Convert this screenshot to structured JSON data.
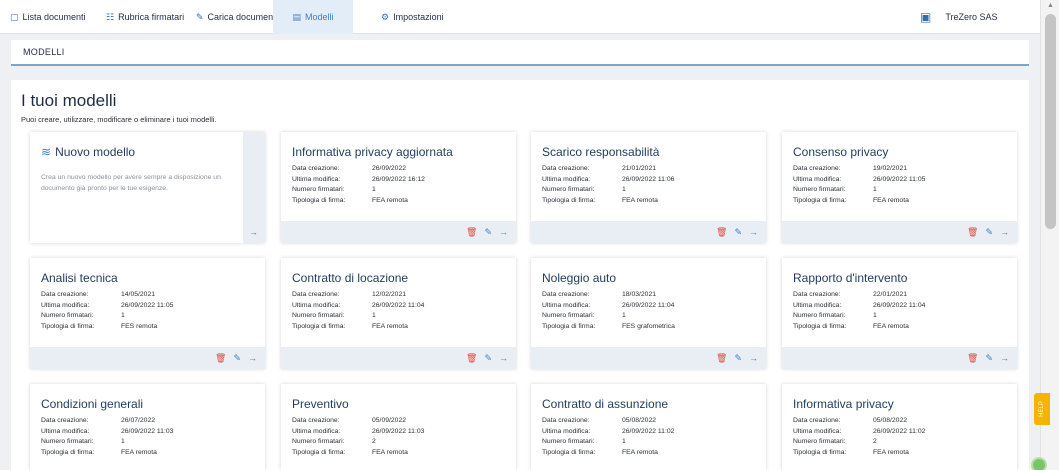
{
  "nav": {
    "items": [
      {
        "icon": "document-icon",
        "label": "Lista documenti"
      },
      {
        "icon": "contacts-icon",
        "label": "Rubrica firmatari"
      },
      {
        "icon": "pen-icon",
        "label": "Carica documento"
      },
      {
        "icon": "template-icon",
        "label": "Modelli",
        "active": true
      },
      {
        "icon": "settings-icon",
        "label": "Impostazioni"
      }
    ],
    "company": {
      "icon": "building-icon",
      "label": "TreZero SAS"
    }
  },
  "section": {
    "label": "MODELLI"
  },
  "page": {
    "title": "I tuoi modelli",
    "subtitle": "Puoi creare, utilizzare, modificare o eliminare i tuoi modelli."
  },
  "new_model": {
    "title": "Nuovo modello",
    "description": "Crea un nuovo modello per avere sempre a disposizione un documento già pronto per le tue esigenze."
  },
  "labels": {
    "created": "Data creazione:",
    "modified": "Ultima modifica:",
    "signers": "Numero firmatari:",
    "signature_type": "Tipologia di firma:"
  },
  "models": [
    {
      "title": "Informativa privacy aggiornata",
      "created": "26/09/2022",
      "modified": "26/09/2022 16:12",
      "signers": "1",
      "signature_type": "FEA remota"
    },
    {
      "title": "Scarico responsabilità",
      "created": "21/01/2021",
      "modified": "26/09/2022 11:06",
      "signers": "1",
      "signature_type": "FEA remota"
    },
    {
      "title": "Consenso privacy",
      "created": "19/02/2021",
      "modified": "26/09/2022 11:05",
      "signers": "1",
      "signature_type": "FEA remota"
    },
    {
      "title": "Analisi tecnica",
      "created": "14/05/2021",
      "modified": "26/09/2022 11:05",
      "signers": "1",
      "signature_type": "FES remota"
    },
    {
      "title": "Contratto di locazione",
      "created": "12/02/2021",
      "modified": "26/09/2022 11:04",
      "signers": "1",
      "signature_type": "FEA remota"
    },
    {
      "title": "Noleggio auto",
      "created": "18/03/2021",
      "modified": "26/09/2022 11:04",
      "signers": "1",
      "signature_type": "FES grafometrica"
    },
    {
      "title": "Rapporto d'intervento",
      "created": "22/01/2021",
      "modified": "26/09/2022 11:04",
      "signers": "1",
      "signature_type": "FEA remota"
    },
    {
      "title": "Condizioni generali",
      "created": "26/07/2022",
      "modified": "26/09/2022 11:03",
      "signers": "1",
      "signature_type": "FEA remota"
    },
    {
      "title": "Preventivo",
      "created": "05/09/2022",
      "modified": "26/09/2022 11:03",
      "signers": "2",
      "signature_type": "FEA remota"
    },
    {
      "title": "Contratto di assunzione",
      "created": "05/08/2022",
      "modified": "26/09/2022 11:02",
      "signers": "1",
      "signature_type": "FEA remota"
    },
    {
      "title": "Informativa privacy",
      "created": "05/08/2022",
      "modified": "26/09/2022 11:02",
      "signers": "2",
      "signature_type": "FEA remota"
    }
  ],
  "help": {
    "label": "HELP"
  },
  "colors": {
    "accent": "#3f7fc0",
    "delete": "#e0483c",
    "help": "#f4b400",
    "footer": "#e9eef4"
  }
}
